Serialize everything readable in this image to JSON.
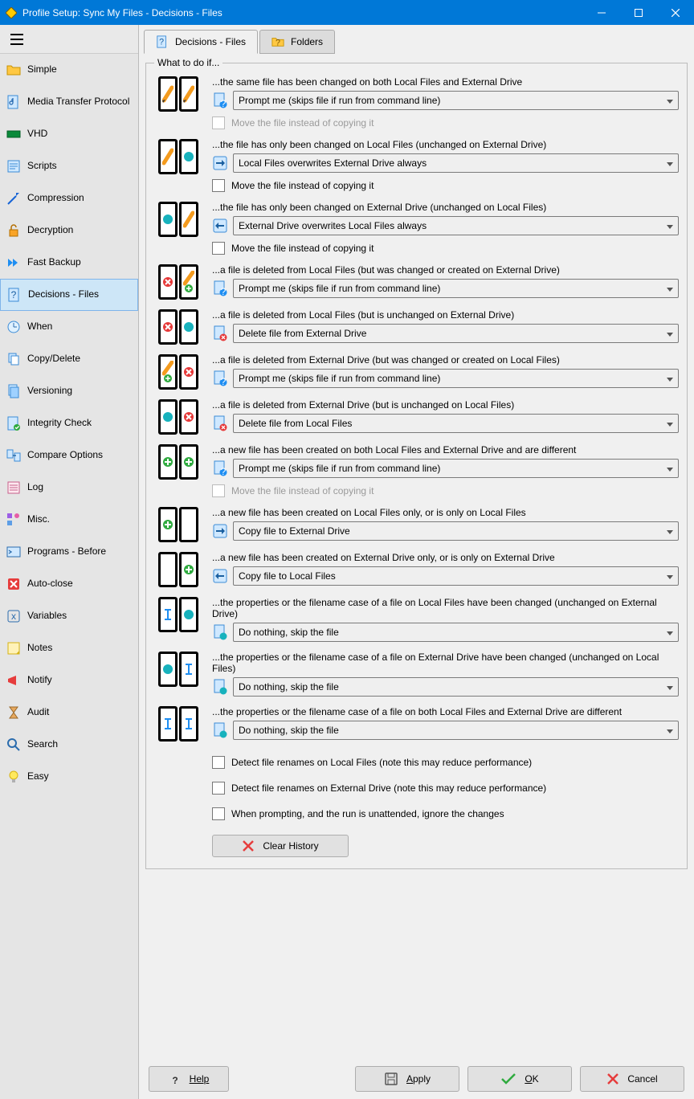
{
  "window": {
    "title": "Profile Setup: Sync My Files - Decisions - Files"
  },
  "tabs": {
    "files": "Decisions - Files",
    "folders": "Folders"
  },
  "sidebar": {
    "items": [
      {
        "label": "Simple"
      },
      {
        "label": "Media Transfer Protocol"
      },
      {
        "label": "VHD"
      },
      {
        "label": "Scripts"
      },
      {
        "label": "Compression"
      },
      {
        "label": "Decryption"
      },
      {
        "label": "Fast Backup"
      },
      {
        "label": "Decisions - Files"
      },
      {
        "label": "When"
      },
      {
        "label": "Copy/Delete"
      },
      {
        "label": "Versioning"
      },
      {
        "label": "Integrity Check"
      },
      {
        "label": "Compare Options"
      },
      {
        "label": "Log"
      },
      {
        "label": "Misc."
      },
      {
        "label": "Programs - Before"
      },
      {
        "label": "Auto-close"
      },
      {
        "label": "Variables"
      },
      {
        "label": "Notes"
      },
      {
        "label": "Notify"
      },
      {
        "label": "Audit"
      },
      {
        "label": "Search"
      },
      {
        "label": "Easy"
      }
    ]
  },
  "groupbox_title": "What to do if...",
  "decisions": [
    {
      "label": "...the same file has been changed on both Local Files and External Drive",
      "value": "Prompt me (skips file if run from command line)",
      "move": "Move the file instead of copying it",
      "move_disabled": "1"
    },
    {
      "label": "...the file has only been changed on Local Files (unchanged on External Drive)",
      "value": "Local Files overwrites External Drive always",
      "move": "Move the file instead of copying it"
    },
    {
      "label": "...the file has only been changed on External Drive (unchanged on Local Files)",
      "value": "External Drive overwrites Local Files always",
      "move": "Move the file instead of copying it"
    },
    {
      "label": "...a file is deleted from Local Files (but was changed or created on External Drive)",
      "value": "Prompt me (skips file if run from command line)"
    },
    {
      "label": "...a file is deleted from Local Files (but is unchanged on External Drive)",
      "value": "Delete file from External Drive"
    },
    {
      "label": "...a file is deleted from External Drive (but was changed or created on Local Files)",
      "value": "Prompt me (skips file if run from command line)"
    },
    {
      "label": "...a file is deleted from External Drive (but is unchanged on Local Files)",
      "value": "Delete file from Local Files"
    },
    {
      "label": "...a new file has been created on both Local Files and External Drive and are different",
      "value": "Prompt me (skips file if run from command line)",
      "move": "Move the file instead of copying it",
      "move_disabled": "1"
    },
    {
      "label": "...a new file has been created on Local Files only, or is only on Local Files",
      "value": "Copy file to External Drive"
    },
    {
      "label": "...a new file has been created on External Drive only, or is only on External Drive",
      "value": "Copy file to Local Files"
    },
    {
      "label": "...the properties or the filename case of a file on Local Files have been changed (unchanged on External Drive)",
      "value": "Do nothing, skip the file"
    },
    {
      "label": "...the properties or the filename case of a file on External Drive have been changed (unchanged on Local Files)",
      "value": "Do nothing, skip the file"
    },
    {
      "label": "...the properties or the filename case of a file on both Local Files and External Drive are different",
      "value": "Do nothing, skip the file"
    }
  ],
  "extra": {
    "detect_local": "Detect file renames on Local Files (note this may reduce performance)",
    "detect_ext": "Detect file renames on External Drive (note this may reduce performance)",
    "unattended": "When prompting, and the run is unattended, ignore the changes",
    "clear_history": "Clear History"
  },
  "footer": {
    "help": "Help",
    "apply": "Apply",
    "ok": "OK",
    "cancel": "Cancel"
  }
}
